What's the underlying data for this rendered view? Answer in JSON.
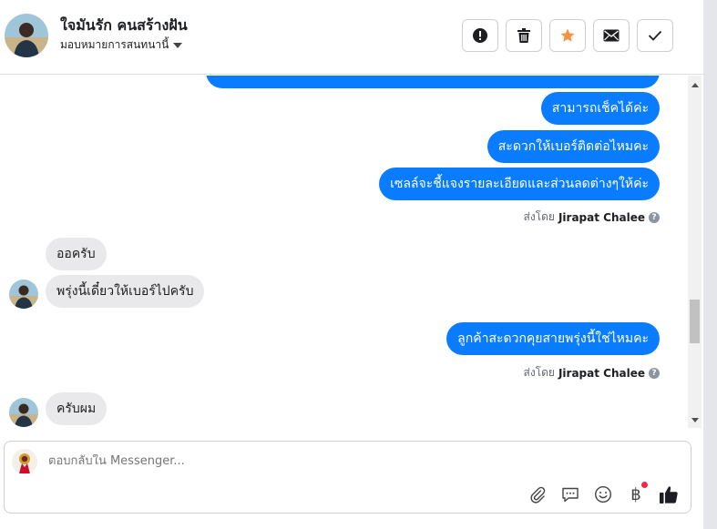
{
  "header": {
    "contact_name": "ใจมันรัก คนสร้างฝัน",
    "assign_label": "มอบหมายการสนทนานี้",
    "actions": [
      {
        "name": "report-button",
        "icon": "exclamation-icon"
      },
      {
        "name": "delete-button",
        "icon": "trash-icon"
      },
      {
        "name": "star-button",
        "icon": "star-icon"
      },
      {
        "name": "mark-unread-button",
        "icon": "envelope-icon"
      },
      {
        "name": "mark-done-button",
        "icon": "check-icon"
      }
    ]
  },
  "messages": {
    "out_1": "สามารถเช็คได้ค่ะ",
    "out_2": "สะดวกให้เบอร์ติดต่อไหมคะ",
    "out_3": "เซลล์จะชี้แจงรายละเอียดและส่วนลดต่างๆให้ค่ะ",
    "sent_by_prefix": "ส่งโดย",
    "sent_by_name": "Jirapat Chalee",
    "in_1": "ออครับ",
    "in_2": "พรุ่งนี้เดี๋ยวให้เบอร์ไปครับ",
    "out_4": "ลูกค้าสะดวกคุยสายพรุ่งนี้ใช่ไหมคะ",
    "in_3": "ครับผม"
  },
  "composer": {
    "placeholder": "ตอบกลับใน Messenger...",
    "currency_symbol": "฿"
  },
  "colors": {
    "outgoing_bubble": "#0a7cff",
    "incoming_bubble": "#e9e9eb",
    "star": "#f5923e",
    "notification_dot": "#f02849"
  }
}
